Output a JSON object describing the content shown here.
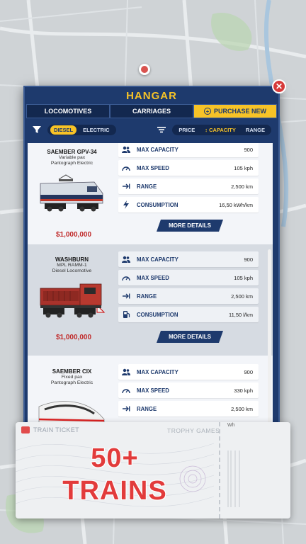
{
  "panel": {
    "title": "HANGAR",
    "close_label": "✕"
  },
  "tabs": [
    {
      "label": "LOCOMOTIVES",
      "active": false
    },
    {
      "label": "CARRIAGES",
      "active": false
    },
    {
      "label": "PURCHASE NEW",
      "active": true
    }
  ],
  "filters": {
    "types": [
      {
        "label": "DIESEL",
        "active": true
      },
      {
        "label": "ELECTRIC",
        "active": false
      }
    ],
    "sorts": [
      {
        "label": "PRICE",
        "active": false
      },
      {
        "label": "↕ CAPACITY",
        "active": false
      },
      {
        "label": "RANGE",
        "active": false
      }
    ]
  },
  "trains": [
    {
      "name": "SAEMBER GPV-34",
      "sub1": "Variable pax",
      "sub2": "Pantograph Electric",
      "price": "$1,000,000",
      "stats": [
        {
          "icon": "people-icon",
          "label": "MAX CAPACITY",
          "value": "900"
        },
        {
          "icon": "speedometer-icon",
          "label": "MAX SPEED",
          "value": "105 kph"
        },
        {
          "icon": "arrow-right-icon",
          "label": "RANGE",
          "value": "2,500 km"
        },
        {
          "icon": "lightning-icon",
          "label": "CONSUMPTION",
          "value": "16,50 kWh/km"
        }
      ],
      "button": "MORE DETAILS"
    },
    {
      "name": "WASHBURN",
      "sub1": "MPL RAMM-1",
      "sub2": "Diesel Locomotive",
      "price": "$1,000,000",
      "stats": [
        {
          "icon": "people-icon",
          "label": "MAX CAPACITY",
          "value": "900"
        },
        {
          "icon": "speedometer-icon",
          "label": "MAX SPEED",
          "value": "105 kph"
        },
        {
          "icon": "arrow-right-icon",
          "label": "RANGE",
          "value": "2,500 km"
        },
        {
          "icon": "fuel-pump-icon",
          "label": "CONSUMPTION",
          "value": "11,50 l/km"
        }
      ],
      "button": "MORE DETAILS"
    },
    {
      "name": "SAEMBER CIX",
      "sub1": "Fixed pax",
      "sub2": "Pantograph Electric",
      "stats": [
        {
          "icon": "people-icon",
          "label": "MAX CAPACITY",
          "value": "900"
        },
        {
          "icon": "speedometer-icon",
          "label": "MAX SPEED",
          "value": "330 kph"
        },
        {
          "icon": "arrow-right-icon",
          "label": "RANGE",
          "value": "2,500 km"
        }
      ]
    }
  ],
  "ticket": {
    "header": "TRAIN TICKET",
    "company": "TROPHY GAMES",
    "corner": "Wh",
    "line1": "50+",
    "line2": "TRAINS"
  },
  "colors": {
    "panel": "#1e3a6d",
    "accent": "#f7c327",
    "price": "#c02a2a",
    "headline": "#e23b3b"
  }
}
